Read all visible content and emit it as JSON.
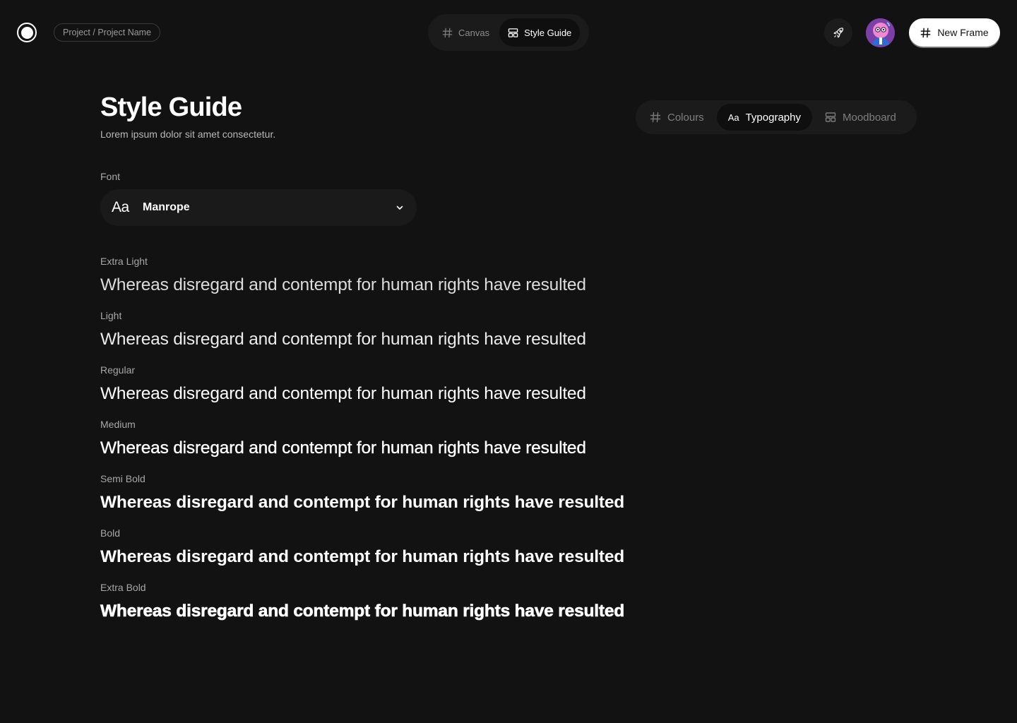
{
  "topbar": {
    "breadcrumb": "Project / Project Name",
    "tabs": [
      {
        "label": "Canvas",
        "icon": "hash-icon",
        "active": false
      },
      {
        "label": "Style Guide",
        "icon": "layout-icon",
        "active": true
      }
    ],
    "new_frame_label": "New Frame",
    "rocket_icon": "rocket-icon",
    "avatar_icon": "user-avatar"
  },
  "header": {
    "title": "Style Guide",
    "subtitle": "Lorem ipsum dolor sit amet consectetur."
  },
  "segments": [
    {
      "label": "Colours",
      "icon": "hash-icon",
      "active": false
    },
    {
      "label": "Typography",
      "icon": "aa-icon",
      "active": true
    },
    {
      "label": "Moodboard",
      "icon": "layout-icon",
      "active": false
    }
  ],
  "font_selector": {
    "label": "Font",
    "glyph": "Aa",
    "value": "Manrope"
  },
  "samples": [
    {
      "label": "Extra Light",
      "text": "Whereas disregard and contempt for human rights have resulted",
      "weight": 200
    },
    {
      "label": "Light",
      "text": "Whereas disregard and contempt for human rights have resulted",
      "weight": 300
    },
    {
      "label": "Regular",
      "text": "Whereas disregard and contempt for human rights have resulted",
      "weight": 400
    },
    {
      "label": "Medium",
      "text": "Whereas disregard and contempt for human rights have resulted",
      "weight": 500
    },
    {
      "label": "Semi Bold",
      "text": "Whereas disregard and contempt for human rights have resulted",
      "weight": 600
    },
    {
      "label": "Bold",
      "text": "Whereas disregard and contempt for human rights have resulted",
      "weight": 700
    },
    {
      "label": "Extra Bold",
      "text": "Whereas disregard and contempt for human rights have resulted",
      "weight": 800
    }
  ],
  "colors": {
    "background": "#121212",
    "surface": "#1b1b1b",
    "active_pill": "#0f0f0f",
    "text_primary": "#ffffff",
    "text_muted": "#a8a8a8"
  }
}
